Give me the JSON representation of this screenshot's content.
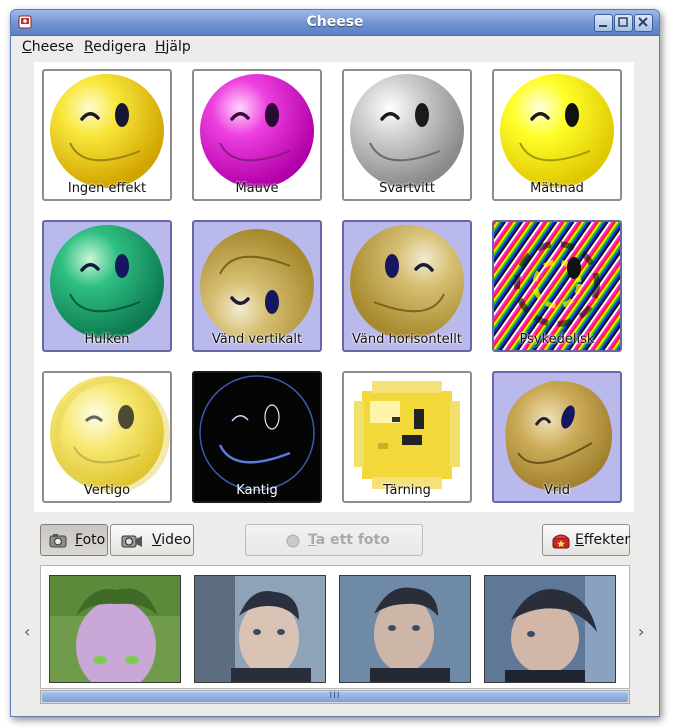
{
  "window": {
    "title": "Cheese"
  },
  "menubar": {
    "items": [
      {
        "first": "C",
        "rest": "heese"
      },
      {
        "first": "R",
        "rest": "edigera"
      },
      {
        "first": "H",
        "rest": "jälp"
      }
    ]
  },
  "effects": [
    {
      "label": "Ingen effekt",
      "selected": false
    },
    {
      "label": "Mauve",
      "selected": false
    },
    {
      "label": "Svartvitt",
      "selected": false
    },
    {
      "label": "Mättnad",
      "selected": false
    },
    {
      "label": "Hulken",
      "selected": true
    },
    {
      "label": "Vänd vertikalt",
      "selected": true
    },
    {
      "label": "Vänd horisontellt",
      "selected": true
    },
    {
      "label": "Psykedelisk",
      "selected": true
    },
    {
      "label": "Vertigo",
      "selected": false
    },
    {
      "label": "Kantig",
      "selected": false
    },
    {
      "label": "Tärning",
      "selected": false
    },
    {
      "label": "Vrid",
      "selected": true
    }
  ],
  "mode": {
    "photo": {
      "first": "F",
      "rest": "oto",
      "pressed": true
    },
    "video": {
      "first": "V",
      "rest": "ideo",
      "pressed": false
    }
  },
  "capture": {
    "first": "T",
    "rest": "a ett foto",
    "enabled": false
  },
  "effects_button": {
    "first": "E",
    "rest": "ffekter"
  },
  "thumbnails": [
    {
      "tint": "#6f9b4a"
    },
    {
      "tint": "#8ea3b8"
    },
    {
      "tint": "#6f8aa6"
    },
    {
      "tint": "#5f7898"
    }
  ],
  "nav": {
    "prev": "‹",
    "next": "›"
  },
  "scrollbar": {
    "grip": "III"
  },
  "colors": {
    "title_blue": "#6f93d2",
    "selected_tile": "#b9b9ec",
    "window_bg": "#edeceb"
  }
}
